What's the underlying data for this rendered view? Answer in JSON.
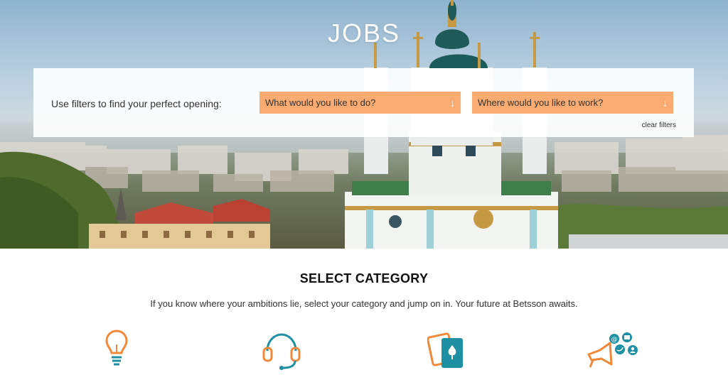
{
  "hero": {
    "title": "JOBS"
  },
  "filters": {
    "prompt": "Use filters to find your perfect opening:",
    "role_dropdown": {
      "selected": "What would you like to do?",
      "arrow_icon": "arrow-down-icon"
    },
    "location_dropdown": {
      "selected": "Where would you like to work?",
      "arrow_icon": "arrow-down-icon"
    },
    "clear_label": "clear filters"
  },
  "category": {
    "title": "SELECT CATEGORY",
    "subtitle": "If you know where your ambitions lie, select your category and jump on in. Your future at Betsson awaits.",
    "icons": [
      "lightbulb-icon",
      "headset-icon",
      "playing-cards-icon",
      "megaphone-social-icon"
    ]
  },
  "colors": {
    "accent_orange": "#f9ab72",
    "icon_orange": "#f08a3a",
    "icon_teal": "#1f8fa3"
  }
}
